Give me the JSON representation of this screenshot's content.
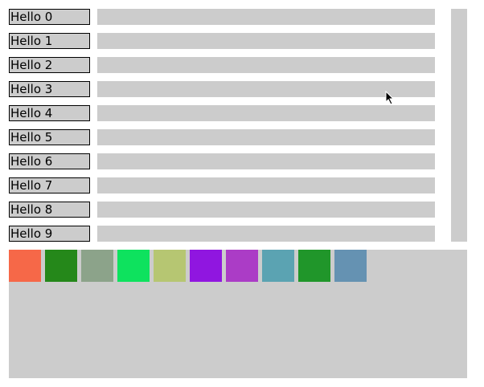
{
  "rows": [
    {
      "label": "Hello 0"
    },
    {
      "label": "Hello 1"
    },
    {
      "label": "Hello 2"
    },
    {
      "label": "Hello 3"
    },
    {
      "label": "Hello 4"
    },
    {
      "label": "Hello 5"
    },
    {
      "label": "Hello 6"
    },
    {
      "label": "Hello 7"
    },
    {
      "label": "Hello 8"
    },
    {
      "label": "Hello 9"
    }
  ],
  "swatches": [
    {
      "color": "#f66848"
    },
    {
      "color": "#25881a"
    },
    {
      "color": "#8ca38a"
    },
    {
      "color": "#0ee25e"
    },
    {
      "color": "#b6c672"
    },
    {
      "color": "#9016e0"
    },
    {
      "color": "#ab3cc6"
    },
    {
      "color": "#5ba3b2"
    },
    {
      "color": "#20962a"
    },
    {
      "color": "#6592b2"
    }
  ]
}
